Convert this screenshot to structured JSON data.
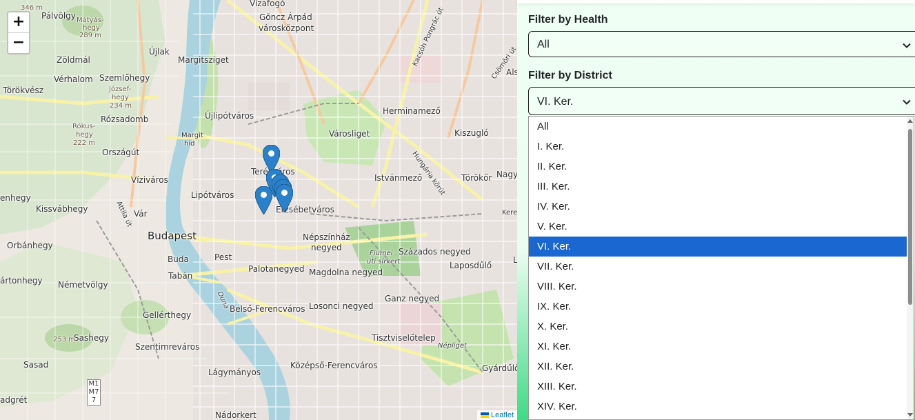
{
  "map": {
    "zoom_in": "+",
    "zoom_out": "−",
    "attribution": "Leaflet",
    "marker_icon": "map-pin-icon",
    "marker_color": "#2a81cb",
    "marker_count": 7,
    "labels": {
      "palvolgy": "Pálvölgy",
      "matyas_hegy": "Mátyás-",
      "matyas_hegy2": "hegy",
      "matyas_elev": "289 m",
      "elev346": "346 m",
      "vizafogo": "Vizafogó",
      "gonczarpad": "Göncz Árpád",
      "varoskozpont": "városközpont",
      "ujlak": "Újlak",
      "margitsziget": "Margitsziget",
      "zoldmal": "Zöldmál",
      "verhalom": "Vérhalom",
      "szemlohegy": "Szemlőhegy",
      "jozsefhegy": "József-",
      "jozsefhegy2": "hegy",
      "jozsef_elev": "234 m",
      "torokvesz": "Törökvész",
      "ujlipotvaros": "Újlipótváros",
      "herminamezo": "Herminamező",
      "rokushegy": "Rókus-",
      "rokushegy2": "hegy",
      "rokus_elev": "222 m",
      "rozsadomb": "Rózsadomb",
      "margit_hid": "Margit",
      "margit_hid2": "híd",
      "varosliget": "Városliget",
      "kiszuglo": "Kiszugló",
      "orszagut": "Országút",
      "terezvaros": "Terézváros",
      "viziváros": "Víziváros",
      "istvanmezo": "Istvánmező",
      "torokor": "Törökőr",
      "nagyp": "Nagy",
      "lipotvaros": "Lipótváros",
      "erzsebetvaros": "Erzsébetváros",
      "enhegy": "enhegy",
      "kissvabhegy": "Kissvábhegy",
      "var": "Vár",
      "budapest": "Budapest",
      "nepszinhaz": "Népszínház",
      "negyed": "negyed",
      "orbanhegy": "Orbánhegy",
      "buda": "Buda",
      "pest": "Pest",
      "fiumei": "Fiumei",
      "utisirkert": "úti sírkert",
      "szazados": "Százados negyed",
      "laposdulo": "Laposdűlő",
      "tabán": "Tabán",
      "palotanegyed": "Palotanegyed",
      "magdolna": "Magdolna negyed",
      "artonhegy": "ártonhegy",
      "nemetvolgy": "Németvölgy",
      "belso": "Belső-Ferencváros",
      "losonci": "Losonci negyed",
      "ganz": "Ganz negyed",
      "gellerthegy": "Gellérthegy",
      "sashegy": "Sashegy",
      "sas_elev": "253 m",
      "tisztviselo": "Tisztviselőtelep",
      "nepliget": "Népliget",
      "szentimre": "Szentimreváros",
      "sasad": "Sasad",
      "kozepso": "Középső-Ferencváros",
      "lagymanyos": "Lágymányos",
      "gyardulo": "Gyárdűlő",
      "nadorkert": "Nádorkert",
      "adgret": "adgrét",
      "als": "Als",
      "csomor": "Csömöri út",
      "kacsoh": "Kacsóh Pongrác út",
      "hungaria": "Hungária körút",
      "attila": "Attila út",
      "duna": "Duna",
      "m1": "M1",
      "m7": "M7",
      "seven": "7",
      "kerep": "Kerep",
      "l": "L"
    }
  },
  "filters": {
    "health_label": "Filter by Health",
    "health_value": "All",
    "district_label": "Filter by District",
    "district_value": "VI. Ker.",
    "chevron_icon": "chevron-down-icon",
    "district_options": [
      "All",
      "I. Ker.",
      "II. Ker.",
      "III. Ker.",
      "IV. Ker.",
      "V. Ker.",
      "VI. Ker.",
      "VII. Ker.",
      "VIII. Ker.",
      "IX. Ker.",
      "X. Ker.",
      "XI. Ker.",
      "XII. Ker.",
      "XIII. Ker.",
      "XIV. Ker."
    ],
    "selected_index": 6,
    "selected_color": "#1a67d2"
  }
}
